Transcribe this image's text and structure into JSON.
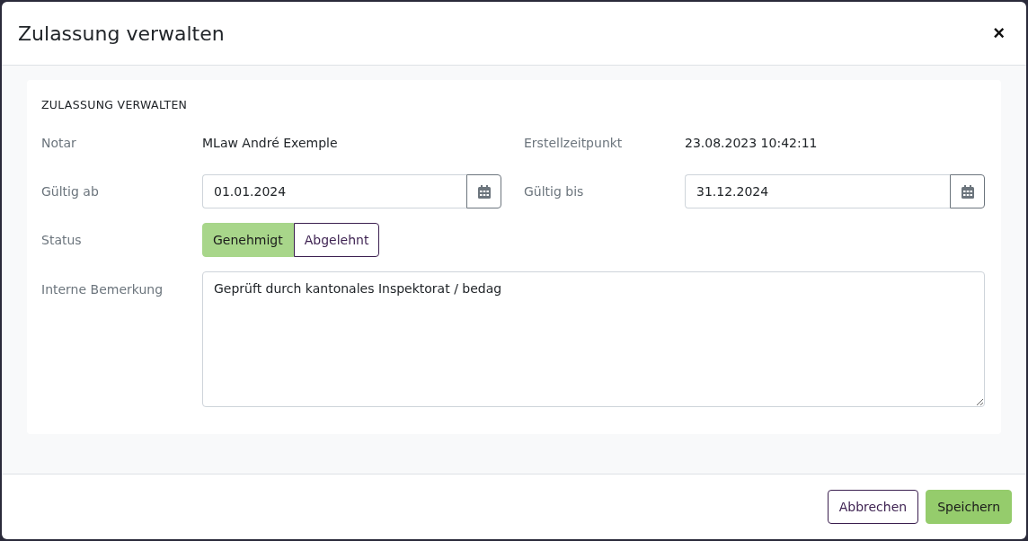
{
  "dialog": {
    "title": "Zulassung verwalten",
    "close_icon": "×"
  },
  "section": {
    "heading": "ZULASSUNG VERWALTEN",
    "fields": [
      {
        "kind": "text",
        "label": "Notar",
        "value": "MLaw André Exemple"
      },
      {
        "kind": "text",
        "label": "Erstellzeitpunkt",
        "value": "23.08.2023 10:42:11"
      },
      {
        "kind": "date",
        "label": "Gültig ab",
        "value": "01.01.2024"
      },
      {
        "kind": "date",
        "label": "Gültig bis",
        "value": "31.12.2024"
      },
      {
        "kind": "toggle",
        "label": "Status",
        "options": [
          {
            "label": "Genehmigt",
            "selected": true
          },
          {
            "label": "Abgelehnt",
            "selected": false
          }
        ]
      },
      {
        "kind": "textarea",
        "label": "Interne Bemerkung",
        "value": "Geprüft durch kantonales Inspektorat / bedag"
      }
    ]
  },
  "buttons": [
    {
      "kind": "secondary",
      "label": "Abbrechen"
    },
    {
      "kind": "primary",
      "label": "Speichern"
    }
  ]
}
